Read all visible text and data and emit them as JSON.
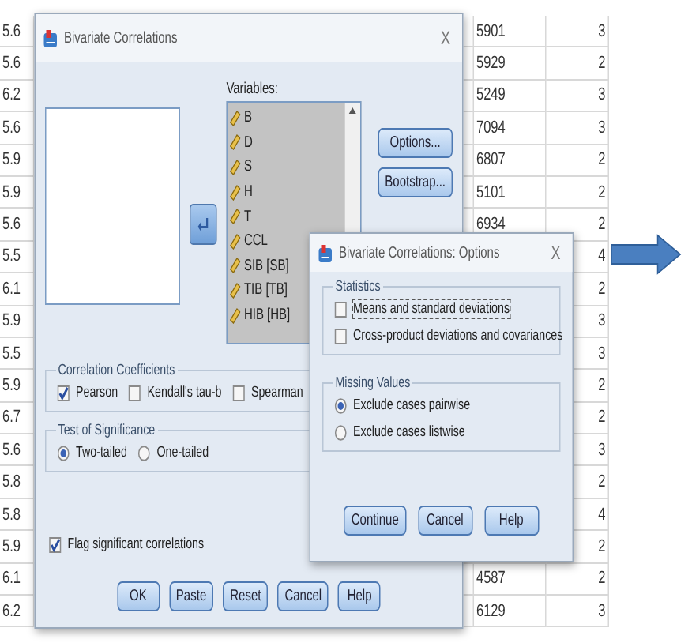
{
  "background_grid": {
    "rows": [
      {
        "column_1": "5.6",
        "column_2": "5901",
        "column_3": "3"
      },
      {
        "column_1": "5.6",
        "column_2": "5929",
        "column_3": "2"
      },
      {
        "column_1": "6.2",
        "column_2": "5249",
        "column_3": "3"
      },
      {
        "column_1": "5.6",
        "column_2": "7094",
        "column_3": "3"
      },
      {
        "column_1": "5.9",
        "column_2": "6807",
        "column_3": "2"
      },
      {
        "column_1": "5.9",
        "column_2": "5101",
        "column_3": "2"
      },
      {
        "column_1": "5.6",
        "column_2": "6934",
        "column_3": "2"
      },
      {
        "column_1": "5.5",
        "column_3": "4"
      },
      {
        "column_1": "6.1",
        "column_3": "2"
      },
      {
        "column_1": "5.9",
        "column_3": "3"
      },
      {
        "column_1": "5.5",
        "column_3": "3"
      },
      {
        "column_1": "5.9",
        "column_3": "2"
      },
      {
        "column_1": "6.7",
        "column_3": "2"
      },
      {
        "column_1": "5.6",
        "column_3": "3"
      },
      {
        "column_1": "5.8",
        "column_3": "2"
      },
      {
        "column_1": "5.8",
        "column_3": "4"
      },
      {
        "column_1": "5.9",
        "column_3": "2"
      },
      {
        "column_1": "6.1",
        "column_2": "4587",
        "column_3": "2"
      },
      {
        "column_1": "6.2",
        "column_2": "6129",
        "column_3": "3"
      }
    ]
  },
  "main_dialog": {
    "title": "Bivariate Correlations",
    "close_label": "X",
    "variables_label": "Variables:",
    "variables": [
      "B",
      "D",
      "S",
      "H",
      "T",
      "CCL",
      "SIB [SB]",
      "TIB [TB]",
      "HIB [HB]"
    ],
    "side_buttons": [
      "Options...",
      "Bootstrap..."
    ],
    "correlation_coefficients": {
      "title": "Correlation Coefficients",
      "options": [
        {
          "label": "Pearson",
          "checked": true
        },
        {
          "label": "Kendall's tau-b",
          "checked": false
        },
        {
          "label": "Spearman",
          "checked": false
        }
      ]
    },
    "test_of_significance": {
      "title": "Test of Significance",
      "options": [
        {
          "label": "Two-tailed",
          "selected": true
        },
        {
          "label": "One-tailed",
          "selected": false
        }
      ]
    },
    "flag_significant": {
      "label": "Flag significant correlations",
      "checked": true
    },
    "buttons": [
      "OK",
      "Paste",
      "Reset",
      "Cancel",
      "Help"
    ]
  },
  "options_dialog": {
    "title": "Bivariate Correlations: Options",
    "close_label": "X",
    "statistics": {
      "title": "Statistics",
      "options": [
        {
          "label": "Means and standard deviations",
          "checked": false
        },
        {
          "label": "Cross-product deviations and covariances",
          "checked": false
        }
      ]
    },
    "missing_values": {
      "title": "Missing Values",
      "options": [
        {
          "label": "Exclude cases pairwise",
          "selected": true
        },
        {
          "label": "Exclude cases listwise",
          "selected": false
        }
      ]
    },
    "buttons": [
      "Continue",
      "Cancel",
      "Help"
    ]
  }
}
